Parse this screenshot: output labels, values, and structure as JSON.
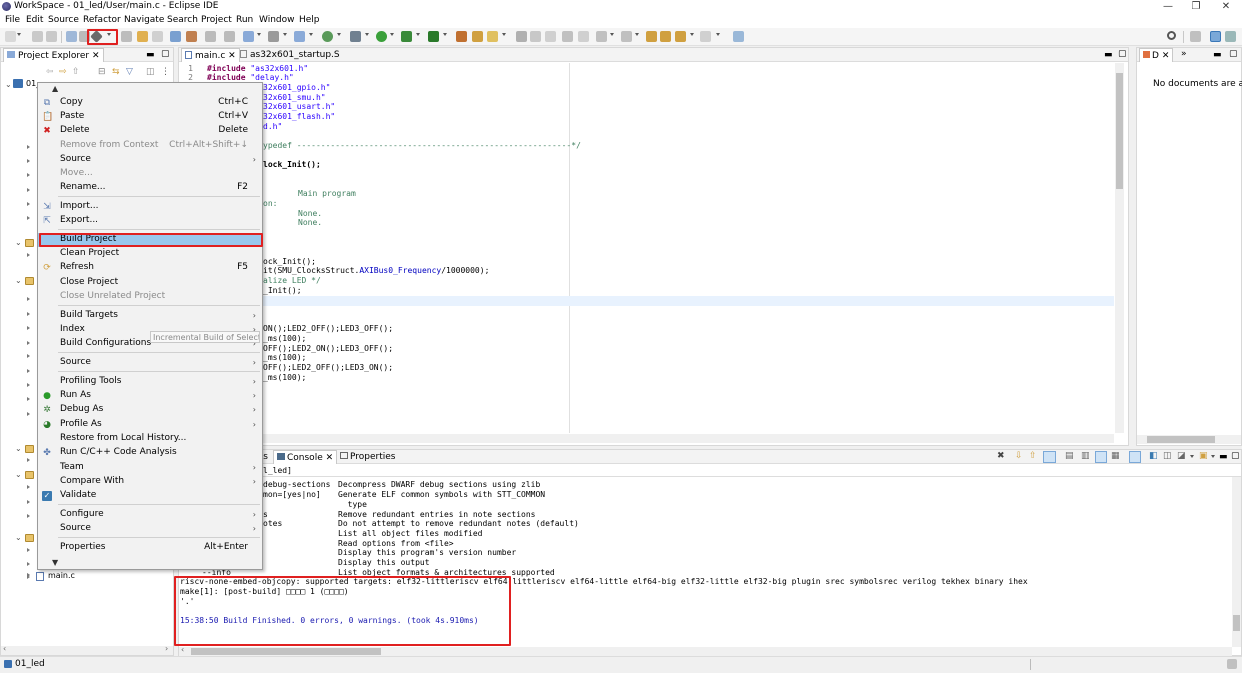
{
  "window": {
    "title": "WorkSpace - 01_led/User/main.c - Eclipse IDE",
    "controls": [
      "—",
      "❐",
      "✕"
    ]
  },
  "menubar": [
    "File",
    "Edit",
    "Source",
    "Refactor",
    "Navigate",
    "Search",
    "Project",
    "Run",
    "Window",
    "Help"
  ],
  "project_explorer": {
    "tab_label": "Project Explorer",
    "root_label": "01_",
    "file_label": "main.c"
  },
  "editor": {
    "tabs": [
      "main.c",
      "as32x601_startup.S"
    ],
    "lines": [
      {
        "n": "1",
        "kw": "#include",
        "str": "\"as32x601.h\""
      },
      {
        "n": "2",
        "kw": "#include",
        "str": "\"delay.h\""
      }
    ],
    "frag": {
      "gpio": "32x601_gpio.h\"",
      "smu": "32x601_smu.h\"",
      "usart": "32x601_usart.h\"",
      "flash": "32x601_flash.h\"",
      "dh": "d.h\"",
      "typedef": "ypedef ---------------------------------------------------------*/",
      "clk_init": "lock_Init();",
      "main_prog": "Main program",
      "on": "on:",
      "none1": "None.",
      "none2": "None.",
      "clk_init2": "ock_Init();",
      "delay_pre": "it(SMU_ClocksStruct.",
      "delay_fld": "AXIBus0_Frequency",
      "delay_post": "/1000000);",
      "alize": "alize LED */",
      "led_init": "_Init();",
      "l1": "ON();LED2_OFF();LED3_OFF();",
      "l2": "_ms(100);",
      "l3": "OFF();LED2_ON();LED3_OFF();",
      "l4": "_ms(100);",
      "l5": "OFF();LED2_OFF();LED3_ON();",
      "l6": "_ms(100);"
    }
  },
  "outline": {
    "tab_label": "D",
    "empty_text": "No documents are avai"
  },
  "bottom_panel": {
    "tabs": {
      "partial": "ks",
      "console": "Console",
      "properties": "Properties"
    },
    "header": "l_led]",
    "help_lines": [
      {
        "opt": "debug-sections",
        "desc": "Decompress DWARF debug sections using zlib"
      },
      {
        "opt": "mon=[yes|no]",
        "desc": "Generate ELF common symbols with STT_COMMON"
      },
      {
        "opt": "",
        "desc": "  type"
      },
      {
        "opt": "s",
        "desc": "Remove redundant entries in note sections"
      },
      {
        "opt": "otes",
        "desc": "Do not attempt to remove redundant notes (default)"
      },
      {
        "opt": "",
        "desc": "List all object files modified"
      },
      {
        "opt": "",
        "desc": "Read options from <file>"
      },
      {
        "opt": "",
        "desc": "Display this program's version number"
      },
      {
        "opt": "",
        "desc": "Display this output"
      },
      {
        "opt": "",
        "desc": "List object formats & architectures supported"
      }
    ],
    "info_line": "--info",
    "targets_line": "riscv-none-embed-objcopy: supported targets: elf32-littleriscv elf64-littleriscv elf64-little elf64-big elf32-little elf32-big plugin srec symbolsrec verilog tekhex binary ihex",
    "make_line": "make[1]: [post-build] □□□□ 1 (□□□□)",
    "dots_line": "'.'",
    "build_finished": "15:38:50 Build Finished. 0 errors, 0 warnings. (took 4s.910ms)"
  },
  "context_menu": {
    "items": [
      {
        "label": "Copy",
        "shortcut": "Ctrl+C",
        "icon": "copy-icon"
      },
      {
        "label": "Paste",
        "shortcut": "Ctrl+V",
        "icon": "paste-icon"
      },
      {
        "label": "Delete",
        "shortcut": "Delete",
        "icon": "delete-icon"
      },
      {
        "label": "Source",
        "submenu": true
      },
      {
        "label": "Remove from Context",
        "shortcut": "Ctrl+Alt+Shift+↓",
        "disabled": true
      },
      {
        "label": "Move...",
        "disabled": true
      },
      {
        "label": "Rename...",
        "shortcut": "F2"
      },
      {
        "label": "Import...",
        "icon": "import-icon"
      },
      {
        "label": "Export...",
        "icon": "export-icon"
      },
      {
        "label": "Build Project",
        "selected": true
      },
      {
        "label": "Clean Project"
      },
      {
        "label": "Refresh",
        "shortcut": "F5",
        "icon": "refresh-icon"
      },
      {
        "label": "Close Project"
      },
      {
        "label": "Close Unrelated Project",
        "disabled": true
      },
      {
        "label": "Build Targets",
        "submenu": true
      },
      {
        "label": "Index",
        "submenu": true
      },
      {
        "label": "Build Configurations",
        "submenu": true
      },
      {
        "label": "Source",
        "submenu": true
      },
      {
        "label": "Profiling Tools",
        "submenu": true
      },
      {
        "label": "Run As",
        "submenu": true,
        "icon": "run-icon"
      },
      {
        "label": "Debug As",
        "submenu": true,
        "icon": "debug-icon"
      },
      {
        "label": "Profile As",
        "submenu": true,
        "icon": "profile-icon"
      },
      {
        "label": "Restore from Local History..."
      },
      {
        "label": "Run C/C++ Code Analysis",
        "icon": "code-analysis-icon"
      },
      {
        "label": "Team",
        "submenu": true
      },
      {
        "label": "Compare With",
        "submenu": true
      },
      {
        "label": "Validate",
        "icon": "validate-icon"
      },
      {
        "label": "Configure",
        "submenu": true
      },
      {
        "label": "Source",
        "submenu": true
      },
      {
        "label": "Properties",
        "shortcut": "Alt+Enter"
      }
    ],
    "tooltip": "Incremental Build of Selected"
  },
  "statusbar": {
    "label": "01_led"
  },
  "colors": {
    "highlight": "#e02020",
    "selection": "#99c7ec",
    "keyword": "#7f0055",
    "string": "#2a00ff",
    "comment": "#3f7f5f",
    "console_blue": "#1a1ab0"
  }
}
